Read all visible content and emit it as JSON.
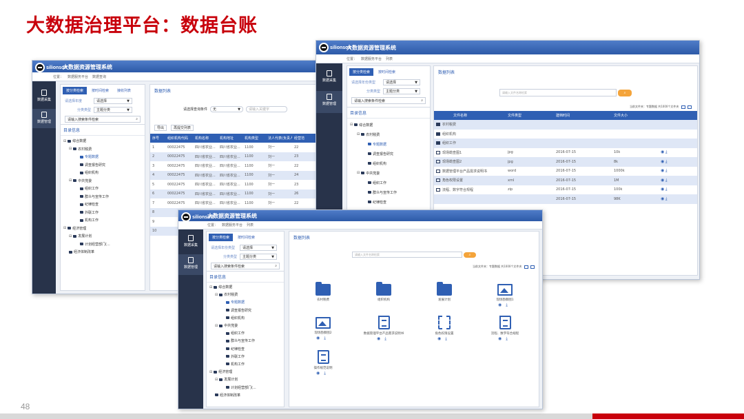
{
  "slide": {
    "title": "大数据治理平台：数据台账",
    "page_number": "48",
    "accent_color": "#c8000b"
  },
  "app": {
    "title": "大数据资源管理系统",
    "logo_text": "silionsoft",
    "nav": {
      "data_collect": "数据采集",
      "data_manage": "数据管理"
    }
  },
  "window_a": {
    "breadcrumb": [
      "位置：",
      "数据服务平台",
      "数据查询"
    ],
    "tabs": [
      "按分类检索",
      "按时间检索",
      "接收列表"
    ],
    "filter_labels": {
      "year": "请选择年度",
      "type": "分类类型"
    },
    "filter_values": {
      "year": "请选择",
      "type": "主题分类"
    },
    "search_placeholder": "请输入搜索条件检索",
    "tree_heading": "目录信息",
    "tree": [
      "综合数据",
      "农村税费",
      "专题数据",
      "调查报告研究",
      "组织机构",
      "中共党委",
      "组织工作",
      "群众与宣传工作",
      "纪律检查",
      "外联工作",
      "机构工作",
      "经济管理",
      "发展计划",
      "计划经营部门(...",
      "经济体制改革"
    ],
    "list_title": "数据列表",
    "query_label": "请选择查询条件",
    "query_select": "无",
    "query_placeholder": "请输入关键字",
    "toolbar": [
      "导出",
      "再提交列表"
    ],
    "table_headers": [
      "序号",
      "组织机构代码",
      "机构名称",
      "机构地址",
      "机构类型",
      "法人代表(负责人)",
      "经营范"
    ],
    "table_rows": [
      [
        "1",
        "00022475",
        "四川省农业...",
        "四川省农业...",
        "1100",
        "刘一",
        "22"
      ],
      [
        "2",
        "00022475",
        "四川省农业...",
        "四川省农业...",
        "1100",
        "刘一",
        "23"
      ],
      [
        "3",
        "00022475",
        "四川省农业...",
        "四川省农业...",
        "1100",
        "刘一",
        "22"
      ],
      [
        "4",
        "00022475",
        "四川省农业...",
        "四川省农业...",
        "1100",
        "刘一",
        "24"
      ],
      [
        "5",
        "00022475",
        "四川省农业...",
        "四川省农业...",
        "1100",
        "刘一",
        "23"
      ],
      [
        "6",
        "00022475",
        "四川省农业...",
        "四川省农业...",
        "1100",
        "刘一",
        "26"
      ],
      [
        "7",
        "00022475",
        "四川省农业...",
        "四川省农业...",
        "1100",
        "刘一",
        "22"
      ],
      [
        "8",
        "",
        "",
        "",
        "",
        "",
        ""
      ],
      [
        "9",
        "",
        "",
        "",
        "",
        "",
        ""
      ],
      [
        "10",
        "",
        "",
        "",
        "",
        "",
        ""
      ]
    ]
  },
  "window_b": {
    "breadcrumb": [
      "位置：",
      "数据服务平台",
      "列表"
    ],
    "tabs": [
      "按分类检索",
      "按时间检索"
    ],
    "filter_labels": {
      "year": "请选择年份类型",
      "type": "分类类型"
    },
    "filter_values": {
      "year": "请选择",
      "type": "主题分类"
    },
    "search_placeholder": "请输入搜索条件检索",
    "tree_heading": "目录信息",
    "tree": [
      "综合数据",
      "农村税费",
      "专题数据",
      "调查报告研究",
      "组织机构",
      "中共党委",
      "组织工作",
      "群众与宣传工作",
      "纪律检查"
    ],
    "list_title": "数据列表",
    "list_search_placeholder": "请输入文件名称检索",
    "meta": "当前文件夹：专题数据  共1000个文件夹",
    "table_headers": [
      "文件名称",
      "文件类型",
      "建档时间",
      "文件大小",
      ""
    ],
    "files": [
      {
        "name": "农村税费",
        "type": "",
        "date": "",
        "size": "",
        "kind": "folder"
      },
      {
        "name": "组织机构",
        "type": "",
        "date": "",
        "size": "",
        "kind": "folder"
      },
      {
        "name": "组织工作",
        "type": "",
        "date": "",
        "size": "",
        "kind": "folder"
      },
      {
        "name": "现场勘查图1",
        "type": "jpg",
        "date": "2016-07-15",
        "size": "10k",
        "kind": "image"
      },
      {
        "name": "现场勘查图2",
        "type": "jpg",
        "date": "2016-07-15",
        "size": "8k",
        "kind": "image"
      },
      {
        "name": "数据管理平台产品需求说明书",
        "type": "word",
        "date": "2016-07-15",
        "size": "1000k",
        "kind": "doc"
      },
      {
        "name": "角色权限设置",
        "type": "xml",
        "date": "2016-07-15",
        "size": "1M",
        "kind": "doc"
      },
      {
        "name": "流程、数字符合规程",
        "type": "zip",
        "date": "2016-07-15",
        "size": "100k",
        "kind": "doc"
      },
      {
        "name": "",
        "type": "",
        "date": "2016-07-15",
        "size": "98K",
        "kind": "blank"
      }
    ]
  },
  "window_c": {
    "breadcrumb": [
      "位置：",
      "数据服务平台",
      "列表"
    ],
    "tabs": [
      "按分类检索",
      "按时间检索"
    ],
    "filter_labels": {
      "year": "请选择年份类型",
      "type": "分类类型"
    },
    "filter_values": {
      "year": "请选择",
      "type": "主题分类"
    },
    "search_placeholder": "请输入搜索条件检索",
    "tree_heading": "目录信息",
    "tree": [
      "综合数据",
      "农村税费",
      "专题数据",
      "调查报告研究",
      "组织机构",
      "中共党委",
      "组织工作",
      "群众与宣传工作",
      "纪律检查",
      "外联工作",
      "机构工作",
      "经济管理",
      "发展计划",
      "计划经营部门(...",
      "经济体制改革"
    ],
    "list_title": "数据列表",
    "list_search_placeholder": "请输入文件名称检索",
    "meta": "当前文件夹：专题数据  共1000个文件夹",
    "tiles": [
      {
        "label": "农村税费",
        "icon": "folder-icon",
        "actions": false
      },
      {
        "label": "组织机构",
        "icon": "folder-icon",
        "actions": false
      },
      {
        "label": "发展计划",
        "icon": "folder-icon",
        "actions": false
      },
      {
        "label": "现场勘察图1",
        "icon": "image-icon",
        "actions": true
      },
      {
        "label": "现场勘察图2",
        "icon": "image-icon",
        "actions": true
      },
      {
        "label": "数据管理平台产品需求说明书",
        "icon": "document-icon",
        "actions": true
      },
      {
        "label": "角色权限设置",
        "icon": "dashed-file-icon",
        "actions": true
      },
      {
        "label": "流程、数字符合规程",
        "icon": "archive-icon",
        "actions": true
      },
      {
        "label": "操作规范说明",
        "icon": "document-icon",
        "actions": true
      }
    ]
  }
}
